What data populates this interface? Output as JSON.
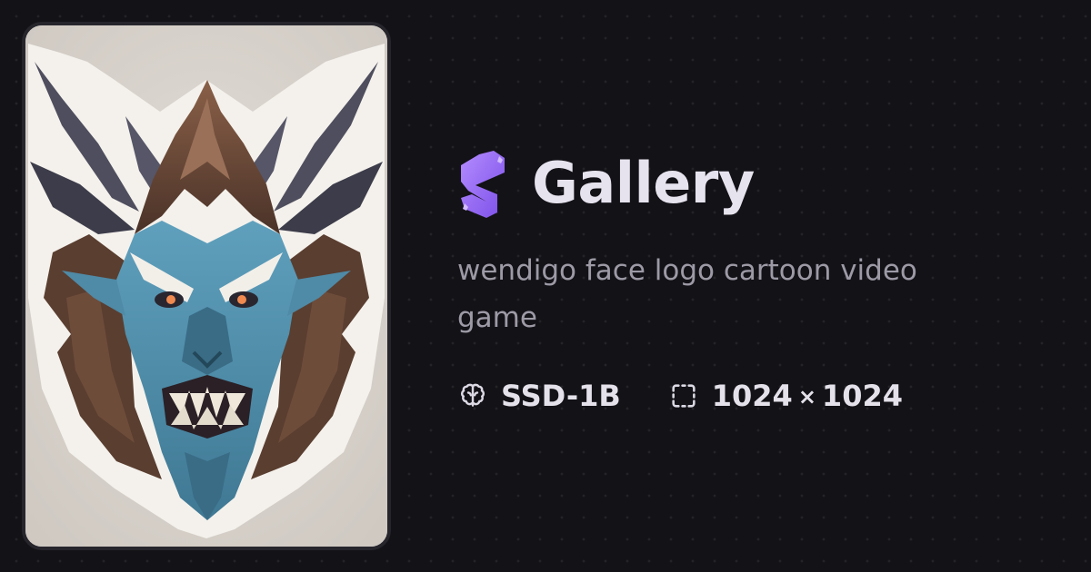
{
  "brand": {
    "title": "Gallery",
    "logo_icon": "stylized-s-logo-icon",
    "accent": "#8a5cf6"
  },
  "image": {
    "subject": "wendigo-face-artwork",
    "background": "#d9d4ce"
  },
  "prompt": "wendigo face logo cartoon video game",
  "meta": {
    "model_icon": "brain-icon",
    "model": "SSD-1B",
    "size_icon": "dashed-square-icon",
    "width": "1024",
    "times": "×",
    "height": "1024"
  },
  "colors": {
    "page_background": "#131217",
    "title_text": "#e7e3ee",
    "prompt_text": "#9d9aa6",
    "meta_text": "#e4e1ea"
  }
}
